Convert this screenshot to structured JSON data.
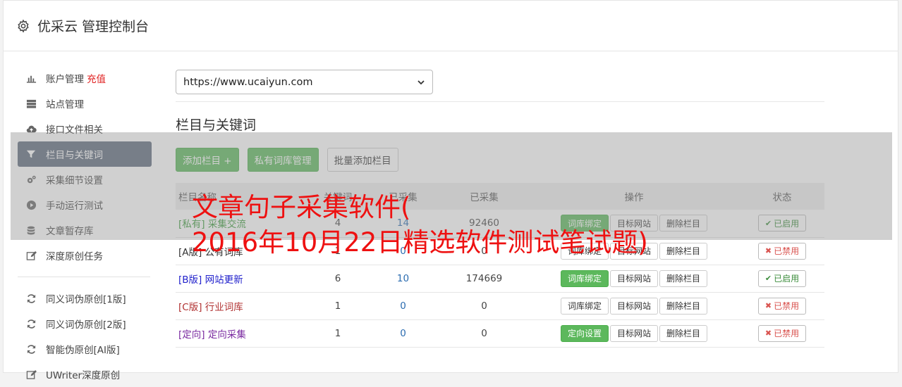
{
  "header": {
    "icon": "gear-icon",
    "title": "优采云 管理控制台"
  },
  "sidebar": {
    "items": [
      {
        "icon": "bar-chart-icon",
        "label": "账户管理",
        "badge": "充值"
      },
      {
        "icon": "server-icon",
        "label": "站点管理"
      },
      {
        "icon": "cloud-upload-icon",
        "label": "接口文件相关"
      },
      {
        "icon": "filter-icon",
        "label": "栏目与关键词",
        "active": true
      },
      {
        "icon": "cogs-icon",
        "label": "采集细节设置"
      },
      {
        "icon": "play-circle-icon",
        "label": "手动运行测试"
      },
      {
        "icon": "database-icon",
        "label": "文章暂存库"
      },
      {
        "icon": "edit-icon",
        "label": "深度原创任务"
      }
    ],
    "items2": [
      {
        "icon": "refresh-icon",
        "label": "同义词伪原创[1版]"
      },
      {
        "icon": "refresh-icon",
        "label": "同义词伪原创[2版]"
      },
      {
        "icon": "refresh-icon",
        "label": "智能伪原创[AI版]"
      },
      {
        "icon": "edit-icon",
        "label": "UWriter深度原创"
      }
    ]
  },
  "site_select": {
    "value": "https://www.ucaiyun.com"
  },
  "section": {
    "title": "栏目与关键词"
  },
  "actions": {
    "add": "添加栏目 +",
    "private_lib": "私有词库管理",
    "batch_add": "批量添加栏目"
  },
  "table": {
    "headers": {
      "name": "栏目名称",
      "col2": "关键词",
      "col3": "已采集",
      "collected": "已采集",
      "ops": "操作",
      "status": "状态"
    },
    "rows": [
      {
        "tag": "[私有]",
        "name": "采集交流",
        "color": "#3a9a3a",
        "a": "4",
        "b": "14",
        "collected": "92460",
        "btn1": "词库绑定",
        "btn1_green": true,
        "btn2": "目标网站",
        "btn3": "删除栏目",
        "status": "已启用",
        "on": true
      },
      {
        "tag": "[A版]",
        "name": "公有词库",
        "color": "#333333",
        "a": "1",
        "b": "0",
        "collected": "0",
        "btn1": "词库绑定",
        "btn1_green": false,
        "btn2": "目标网站",
        "btn3": "删除栏目",
        "status": "已禁用",
        "on": false
      },
      {
        "tag": "[B版]",
        "name": "网站更新",
        "color": "#2222cc",
        "a": "6",
        "b": "10",
        "collected": "174669",
        "btn1": "词库绑定",
        "btn1_green": true,
        "btn2": "目标网站",
        "btn3": "删除栏目",
        "status": "已启用",
        "on": true
      },
      {
        "tag": "[C版]",
        "name": "行业词库",
        "color": "#b03030",
        "a": "1",
        "b": "0",
        "collected": "0",
        "btn1": "词库绑定",
        "btn1_green": false,
        "btn2": "目标网站",
        "btn3": "删除栏目",
        "status": "已禁用",
        "on": false
      },
      {
        "tag": "[定向]",
        "name": "定向采集",
        "color": "#7a2aa0",
        "a": "1",
        "b": "0",
        "collected": "0",
        "btn1": "定向设置",
        "btn1_green": true,
        "btn2": "目标网站",
        "btn3": "删除栏目",
        "status": "已禁用",
        "on": false
      }
    ]
  },
  "watermark": {
    "line1": "文章句子采集软件(",
    "line2": "2016年10月22日精选软件测试笔试题)"
  }
}
